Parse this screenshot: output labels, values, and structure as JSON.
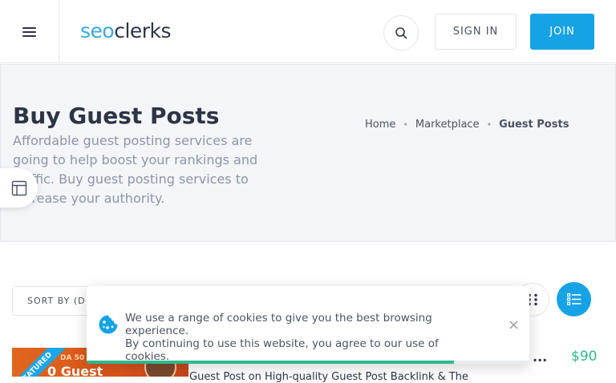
{
  "header": {
    "logo_part1": "seo",
    "logo_part2": "clerks",
    "signin_label": "SIGN IN",
    "join_label": "JOIN",
    "icons": {
      "menu": "hamburger-menu-icon",
      "search": "search-icon"
    }
  },
  "hero": {
    "title": "Buy Guest Posts",
    "description": "Affordable guest posting services are going to help boost your rankings and traffic. Buy guest posting services to increase your authority.",
    "breadcrumb": [
      {
        "label": "Home"
      },
      {
        "label": "Marketplace"
      },
      {
        "label": "Guest Posts"
      }
    ],
    "separator": "•"
  },
  "toolbar": {
    "sort_label": "SORT BY (D",
    "icons": {
      "grid": "grid-view-icon",
      "list": "list-view-icon"
    }
  },
  "listing": {
    "ribbon": "FEATURED",
    "thumb_small_text": "DA 50 - 9",
    "thumb_large_text": "0 Guest",
    "title": "Guest Post on High-quality Guest Post Backlink & The",
    "more": "...",
    "price": "$90"
  },
  "cookie_banner": {
    "line1": "We use a range of cookies to give you the best browsing experience.",
    "line2": "By continuing to use this website, you agree to our use of cookies.",
    "progress": 0.83,
    "icons": {
      "cookie": "cookie-icon",
      "close": "close-icon"
    }
  },
  "colors": {
    "brand_blue": "#16a3e6",
    "logo_blue": "#3aa9e0",
    "price_green": "#2fb88e",
    "text_dark": "#2d3446"
  }
}
